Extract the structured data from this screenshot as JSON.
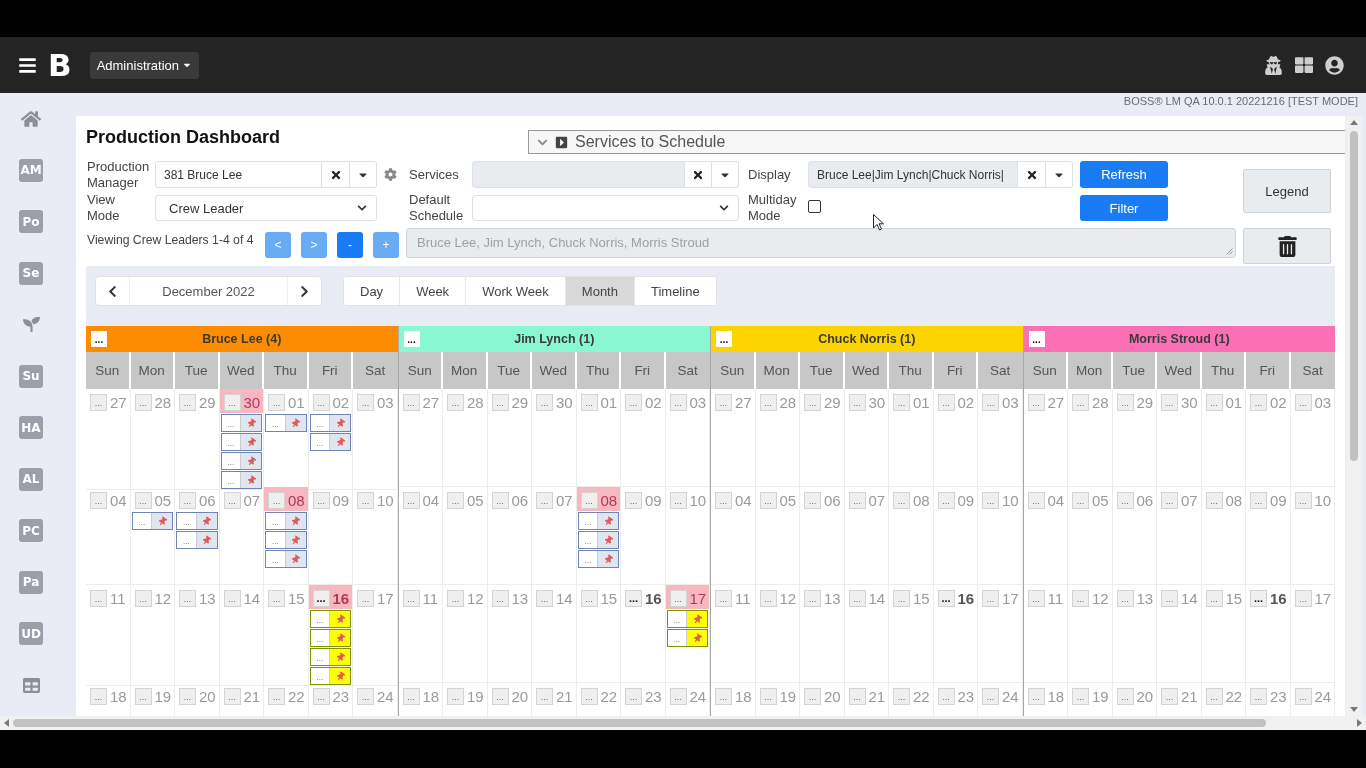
{
  "top_bar": {
    "logo": "B",
    "menu": "Administration"
  },
  "version_label": "BOSS® LM QA 10.0.1 20221216 [TEST MODE]",
  "sidebar": {
    "items": [
      {
        "kind": "home"
      },
      {
        "kind": "badge",
        "label": "AM"
      },
      {
        "kind": "badge",
        "label": "Po"
      },
      {
        "kind": "badge",
        "label": "Se"
      },
      {
        "kind": "sprout"
      },
      {
        "kind": "badge",
        "label": "Su"
      },
      {
        "kind": "badge",
        "label": "HA"
      },
      {
        "kind": "badge",
        "label": "AL"
      },
      {
        "kind": "badge",
        "label": "PC"
      },
      {
        "kind": "badge",
        "label": "Pa"
      },
      {
        "kind": "badge",
        "label": "UD"
      },
      {
        "kind": "table"
      }
    ]
  },
  "page": {
    "title": "Production Dashboard"
  },
  "services_panel": {
    "title": "Services to Schedule"
  },
  "filters": {
    "production_manager": {
      "label": "Production Manager",
      "value": "381 Bruce Lee"
    },
    "services": {
      "label": "Services"
    },
    "display": {
      "label": "Display",
      "value": "Bruce Lee|Jim Lynch|Chuck Norris|"
    },
    "view_mode": {
      "label": "View Mode",
      "value": "Crew Leader"
    },
    "default_schedule": {
      "label": "Default Schedule"
    },
    "multiday_mode": {
      "label": "Multiday Mode",
      "checked": false
    }
  },
  "buttons": {
    "refresh": "Refresh",
    "filter": "Filter",
    "legend": "Legend"
  },
  "crew_pager": {
    "text": "Viewing Crew Leaders 1-4 of 4",
    "buttons": [
      {
        "label": "<",
        "disabled": true
      },
      {
        "label": ">",
        "disabled": true
      },
      {
        "label": "-",
        "disabled": false
      },
      {
        "label": "+",
        "disabled": true
      }
    ],
    "names": "Bruce Lee, Jim Lynch, Chuck Norris, Morris Stroud"
  },
  "calendar": {
    "month": "December 2022",
    "views": [
      {
        "label": "Day",
        "selected": false
      },
      {
        "label": "Week",
        "selected": false
      },
      {
        "label": "Work Week",
        "selected": false
      },
      {
        "label": "Month",
        "selected": true
      },
      {
        "label": "Timeline",
        "selected": false
      }
    ],
    "crews": [
      {
        "name": "Bruce Lee (4)",
        "color": "#fd8c00",
        "button": "...",
        "weekdays": [
          "Sun",
          "Mon",
          "Tue",
          "Wed",
          "Thu",
          "Fri",
          "Sat"
        ],
        "weeks": [
          [
            {
              "button": "...",
              "day": "27",
              "highlighted": false,
              "bold": false
            },
            {
              "button": "...",
              "day": "28",
              "highlighted": false,
              "bold": false
            },
            {
              "button": "...",
              "day": "29",
              "highlighted": false,
              "bold": false
            },
            {
              "button": "...",
              "day": "30",
              "highlighted": true,
              "bold": false,
              "events": [
                {
                  "button": "...",
                  "color": "#dfe6f0"
                },
                {
                  "button": "...",
                  "color": "#dfe6f0"
                },
                {
                  "button": "...",
                  "color": "#dfe6f0"
                },
                {
                  "button": "...",
                  "color": "#dfe6f0"
                }
              ]
            },
            {
              "button": "...",
              "day": "01",
              "highlighted": false,
              "bold": false,
              "events": [
                {
                  "button": "...",
                  "color": "#dfe6f0"
                }
              ]
            },
            {
              "button": "...",
              "day": "02",
              "highlighted": false,
              "bold": false,
              "events": [
                {
                  "button": "...",
                  "color": "#dfe6f0"
                },
                {
                  "button": "...",
                  "color": "#dfe6f0"
                }
              ]
            },
            {
              "button": "...",
              "day": "03",
              "highlighted": false,
              "bold": false
            }
          ],
          [
            {
              "button": "...",
              "day": "04",
              "highlighted": false,
              "bold": false
            },
            {
              "button": "...",
              "day": "05",
              "highlighted": false,
              "bold": false,
              "events": [
                {
                  "button": "...",
                  "color": "#dfe6f0"
                }
              ]
            },
            {
              "button": "...",
              "day": "06",
              "highlighted": false,
              "bold": false,
              "events": [
                {
                  "button": "...",
                  "color": "#dfe6f0"
                },
                {
                  "button": "...",
                  "color": "#dfe6f0"
                }
              ]
            },
            {
              "button": "...",
              "day": "07",
              "highlighted": false,
              "bold": false
            },
            {
              "button": "...",
              "day": "08",
              "highlighted": true,
              "bold": false,
              "events": [
                {
                  "button": "...",
                  "color": "#dfe6f0"
                },
                {
                  "button": "...",
                  "color": "#dfe6f0"
                },
                {
                  "button": "...",
                  "color": "#dfe6f0"
                }
              ]
            },
            {
              "button": "...",
              "day": "09",
              "highlighted": false,
              "bold": false
            },
            {
              "button": "...",
              "day": "10",
              "highlighted": false,
              "bold": false
            }
          ],
          [
            {
              "button": "...",
              "day": "11",
              "highlighted": false,
              "bold": false
            },
            {
              "button": "...",
              "day": "12",
              "highlighted": false,
              "bold": false
            },
            {
              "button": "...",
              "day": "13",
              "highlighted": false,
              "bold": false
            },
            {
              "button": "...",
              "day": "14",
              "highlighted": false,
              "bold": false
            },
            {
              "button": "...",
              "day": "15",
              "highlighted": false,
              "bold": false
            },
            {
              "button": "...",
              "day": "16",
              "highlighted": true,
              "bold": true,
              "events": [
                {
                  "button": "...",
                  "color": "#ffff00"
                },
                {
                  "button": "...",
                  "color": "#ffff00"
                },
                {
                  "button": "...",
                  "color": "#ffff00"
                },
                {
                  "button": "...",
                  "color": "#ffff00"
                }
              ]
            },
            {
              "button": "...",
              "day": "17",
              "highlighted": false,
              "bold": false
            }
          ],
          [
            {
              "button": "...",
              "day": "18",
              "highlighted": false,
              "bold": false
            },
            {
              "button": "...",
              "day": "19",
              "highlighted": false,
              "bold": false
            },
            {
              "button": "...",
              "day": "20",
              "highlighted": false,
              "bold": false
            },
            {
              "button": "...",
              "day": "21",
              "highlighted": false,
              "bold": false
            },
            {
              "button": "...",
              "day": "22",
              "highlighted": false,
              "bold": false
            },
            {
              "button": "...",
              "day": "23",
              "highlighted": false,
              "bold": false
            },
            {
              "button": "...",
              "day": "24",
              "highlighted": false,
              "bold": false
            }
          ]
        ]
      },
      {
        "name": "Jim Lynch (1)",
        "color": "#88f7d2",
        "button": "...",
        "weekdays": [
          "Sun",
          "Mon",
          "Tue",
          "Wed",
          "Thu",
          "Fri",
          "Sat"
        ],
        "weeks": [
          [
            {
              "button": "...",
              "day": "27",
              "highlighted": false,
              "bold": false
            },
            {
              "button": "...",
              "day": "28",
              "highlighted": false,
              "bold": false
            },
            {
              "button": "...",
              "day": "29",
              "highlighted": false,
              "bold": false
            },
            {
              "button": "...",
              "day": "30",
              "highlighted": false,
              "bold": false
            },
            {
              "button": "...",
              "day": "01",
              "highlighted": false,
              "bold": false
            },
            {
              "button": "...",
              "day": "02",
              "highlighted": false,
              "bold": false
            },
            {
              "button": "...",
              "day": "03",
              "highlighted": false,
              "bold": false
            }
          ],
          [
            {
              "button": "...",
              "day": "04",
              "highlighted": false,
              "bold": false
            },
            {
              "button": "...",
              "day": "05",
              "highlighted": false,
              "bold": false
            },
            {
              "button": "...",
              "day": "06",
              "highlighted": false,
              "bold": false
            },
            {
              "button": "...",
              "day": "07",
              "highlighted": false,
              "bold": false
            },
            {
              "button": "...",
              "day": "08",
              "highlighted": true,
              "bold": false,
              "events": [
                {
                  "button": "...",
                  "color": "#dfe6f0"
                },
                {
                  "button": "...",
                  "color": "#dfe6f0"
                },
                {
                  "button": "...",
                  "color": "#dfe6f0"
                }
              ]
            },
            {
              "button": "...",
              "day": "09",
              "highlighted": false,
              "bold": false
            },
            {
              "button": "...",
              "day": "10",
              "highlighted": false,
              "bold": false
            }
          ],
          [
            {
              "button": "...",
              "day": "11",
              "highlighted": false,
              "bold": false
            },
            {
              "button": "...",
              "day": "12",
              "highlighted": false,
              "bold": false
            },
            {
              "button": "...",
              "day": "13",
              "highlighted": false,
              "bold": false
            },
            {
              "button": "...",
              "day": "14",
              "highlighted": false,
              "bold": false
            },
            {
              "button": "...",
              "day": "15",
              "highlighted": false,
              "bold": false
            },
            {
              "button": "...",
              "day": "16",
              "highlighted": false,
              "bold": true
            },
            {
              "button": "...",
              "day": "17",
              "highlighted": true,
              "bold": false,
              "events": [
                {
                  "button": "...",
                  "color": "#ffff00"
                },
                {
                  "button": "...",
                  "color": "#ffff00"
                }
              ]
            }
          ],
          [
            {
              "button": "...",
              "day": "18",
              "highlighted": false,
              "bold": false
            },
            {
              "button": "...",
              "day": "19",
              "highlighted": false,
              "bold": false
            },
            {
              "button": "...",
              "day": "20",
              "highlighted": false,
              "bold": false
            },
            {
              "button": "...",
              "day": "21",
              "highlighted": false,
              "bold": false
            },
            {
              "button": "...",
              "day": "22",
              "highlighted": false,
              "bold": false
            },
            {
              "button": "...",
              "day": "23",
              "highlighted": false,
              "bold": false
            },
            {
              "button": "...",
              "day": "24",
              "highlighted": false,
              "bold": false
            }
          ]
        ]
      },
      {
        "name": "Chuck Norris (1)",
        "color": "#fcd400",
        "button": "...",
        "weekdays": [
          "Sun",
          "Mon",
          "Tue",
          "Wed",
          "Thu",
          "Fri",
          "Sat"
        ],
        "weeks": [
          [
            {
              "button": "...",
              "day": "27",
              "highlighted": false,
              "bold": false
            },
            {
              "button": "...",
              "day": "28",
              "highlighted": false,
              "bold": false
            },
            {
              "button": "...",
              "day": "29",
              "highlighted": false,
              "bold": false
            },
            {
              "button": "...",
              "day": "30",
              "highlighted": false,
              "bold": false
            },
            {
              "button": "...",
              "day": "01",
              "highlighted": false,
              "bold": false
            },
            {
              "button": "...",
              "day": "02",
              "highlighted": false,
              "bold": false
            },
            {
              "button": "...",
              "day": "03",
              "highlighted": false,
              "bold": false
            }
          ],
          [
            {
              "button": "...",
              "day": "04",
              "highlighted": false,
              "bold": false
            },
            {
              "button": "...",
              "day": "05",
              "highlighted": false,
              "bold": false
            },
            {
              "button": "...",
              "day": "06",
              "highlighted": false,
              "bold": false
            },
            {
              "button": "...",
              "day": "07",
              "highlighted": false,
              "bold": false
            },
            {
              "button": "...",
              "day": "08",
              "highlighted": false,
              "bold": false
            },
            {
              "button": "...",
              "day": "09",
              "highlighted": false,
              "bold": false
            },
            {
              "button": "...",
              "day": "10",
              "highlighted": false,
              "bold": false
            }
          ],
          [
            {
              "button": "...",
              "day": "11",
              "highlighted": false,
              "bold": false
            },
            {
              "button": "...",
              "day": "12",
              "highlighted": false,
              "bold": false
            },
            {
              "button": "...",
              "day": "13",
              "highlighted": false,
              "bold": false
            },
            {
              "button": "...",
              "day": "14",
              "highlighted": false,
              "bold": false
            },
            {
              "button": "...",
              "day": "15",
              "highlighted": false,
              "bold": false
            },
            {
              "button": "...",
              "day": "16",
              "highlighted": false,
              "bold": true
            },
            {
              "button": "...",
              "day": "17",
              "highlighted": false,
              "bold": false
            }
          ],
          [
            {
              "button": "...",
              "day": "18",
              "highlighted": false,
              "bold": false
            },
            {
              "button": "...",
              "day": "19",
              "highlighted": false,
              "bold": false
            },
            {
              "button": "...",
              "day": "20",
              "highlighted": false,
              "bold": false
            },
            {
              "button": "...",
              "day": "21",
              "highlighted": false,
              "bold": false
            },
            {
              "button": "...",
              "day": "22",
              "highlighted": false,
              "bold": false
            },
            {
              "button": "...",
              "day": "23",
              "highlighted": false,
              "bold": false
            },
            {
              "button": "...",
              "day": "24",
              "highlighted": false,
              "bold": false
            }
          ]
        ]
      },
      {
        "name": "Morris Stroud (1)",
        "color": "#fb70b4",
        "button": "...",
        "weekdays": [
          "Sun",
          "Mon",
          "Tue",
          "Wed",
          "Thu",
          "Fri",
          "Sat"
        ],
        "weeks": [
          [
            {
              "button": "...",
              "day": "27",
              "highlighted": false,
              "bold": false
            },
            {
              "button": "...",
              "day": "28",
              "highlighted": false,
              "bold": false
            },
            {
              "button": "...",
              "day": "29",
              "highlighted": false,
              "bold": false
            },
            {
              "button": "...",
              "day": "30",
              "highlighted": false,
              "bold": false
            },
            {
              "button": "...",
              "day": "01",
              "highlighted": false,
              "bold": false
            },
            {
              "button": "...",
              "day": "02",
              "highlighted": false,
              "bold": false
            },
            {
              "button": "...",
              "day": "03",
              "highlighted": false,
              "bold": false
            }
          ],
          [
            {
              "button": "...",
              "day": "04",
              "highlighted": false,
              "bold": false
            },
            {
              "button": "...",
              "day": "05",
              "highlighted": false,
              "bold": false
            },
            {
              "button": "...",
              "day": "06",
              "highlighted": false,
              "bold": false
            },
            {
              "button": "...",
              "day": "07",
              "highlighted": false,
              "bold": false
            },
            {
              "button": "...",
              "day": "08",
              "highlighted": false,
              "bold": false
            },
            {
              "button": "...",
              "day": "09",
              "highlighted": false,
              "bold": false
            },
            {
              "button": "...",
              "day": "10",
              "highlighted": false,
              "bold": false
            }
          ],
          [
            {
              "button": "...",
              "day": "11",
              "highlighted": false,
              "bold": false
            },
            {
              "button": "...",
              "day": "12",
              "highlighted": false,
              "bold": false
            },
            {
              "button": "...",
              "day": "13",
              "highlighted": false,
              "bold": false
            },
            {
              "button": "...",
              "day": "14",
              "highlighted": false,
              "bold": false
            },
            {
              "button": "...",
              "day": "15",
              "highlighted": false,
              "bold": false
            },
            {
              "button": "...",
              "day": "16",
              "highlighted": false,
              "bold": true
            },
            {
              "button": "...",
              "day": "17",
              "highlighted": false,
              "bold": false
            }
          ],
          [
            {
              "button": "...",
              "day": "18",
              "highlighted": false,
              "bold": false
            },
            {
              "button": "...",
              "day": "19",
              "highlighted": false,
              "bold": false
            },
            {
              "button": "...",
              "day": "20",
              "highlighted": false,
              "bold": false
            },
            {
              "button": "...",
              "day": "21",
              "highlighted": false,
              "bold": false
            },
            {
              "button": "...",
              "day": "22",
              "highlighted": false,
              "bold": false
            },
            {
              "button": "...",
              "day": "23",
              "highlighted": false,
              "bold": false
            },
            {
              "button": "...",
              "day": "24",
              "highlighted": false,
              "bold": false
            }
          ]
        ]
      }
    ]
  }
}
